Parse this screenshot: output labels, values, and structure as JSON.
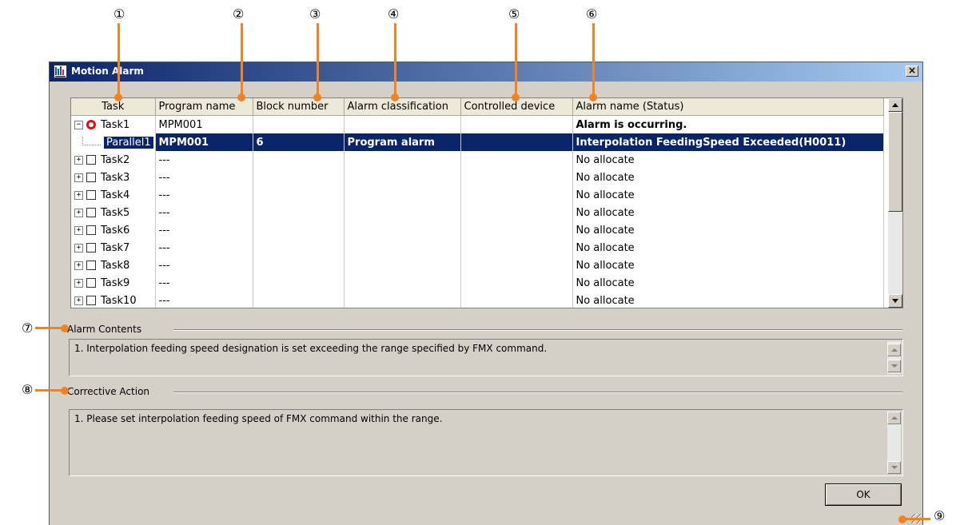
{
  "callouts": [
    "①",
    "②",
    "③",
    "④",
    "⑤",
    "⑥",
    "⑦",
    "⑧",
    "⑨"
  ],
  "window": {
    "title": "Motion Alarm",
    "close_glyph": "×"
  },
  "grid": {
    "columns": [
      "Task",
      "Program name",
      "Block number",
      "Alarm classification",
      "Controlled device",
      "Alarm name (Status)"
    ],
    "rows": [
      {
        "expander": "−",
        "marker": "alarm",
        "task": "Task1",
        "program": "MPM001",
        "block": "",
        "classification": "",
        "device": "",
        "status": "Alarm is occurring.",
        "status_style": "red"
      },
      {
        "expander": "",
        "marker": "child",
        "task": "Parallel1",
        "program": "MPM001",
        "block": "6",
        "classification": "Program alarm",
        "device": "",
        "status": "Interpolation FeedingSpeed Exceeded(H0011)",
        "selected": true
      },
      {
        "expander": "+",
        "marker": "check",
        "task": "Task2",
        "program": "---",
        "block": "",
        "classification": "",
        "device": "",
        "status": "No allocate"
      },
      {
        "expander": "+",
        "marker": "check",
        "task": "Task3",
        "program": "---",
        "block": "",
        "classification": "",
        "device": "",
        "status": "No allocate"
      },
      {
        "expander": "+",
        "marker": "check",
        "task": "Task4",
        "program": "---",
        "block": "",
        "classification": "",
        "device": "",
        "status": "No allocate"
      },
      {
        "expander": "+",
        "marker": "check",
        "task": "Task5",
        "program": "---",
        "block": "",
        "classification": "",
        "device": "",
        "status": "No allocate"
      },
      {
        "expander": "+",
        "marker": "check",
        "task": "Task6",
        "program": "---",
        "block": "",
        "classification": "",
        "device": "",
        "status": "No allocate"
      },
      {
        "expander": "+",
        "marker": "check",
        "task": "Task7",
        "program": "---",
        "block": "",
        "classification": "",
        "device": "",
        "status": "No allocate"
      },
      {
        "expander": "+",
        "marker": "check",
        "task": "Task8",
        "program": "---",
        "block": "",
        "classification": "",
        "device": "",
        "status": "No allocate"
      },
      {
        "expander": "+",
        "marker": "check",
        "task": "Task9",
        "program": "---",
        "block": "",
        "classification": "",
        "device": "",
        "status": "No allocate"
      },
      {
        "expander": "+",
        "marker": "check",
        "task": "Task10",
        "program": "---",
        "block": "",
        "classification": "",
        "device": "",
        "status": "No allocate"
      }
    ]
  },
  "alarm_contents": {
    "label": "Alarm Contents",
    "text": "1. Interpolation feeding speed designation is set exceeding the range specified by FMX command."
  },
  "corrective_action": {
    "label": "Corrective Action",
    "text": "1. Please set interpolation feeding speed of FMX command within the range."
  },
  "ok_button": {
    "label": "OK"
  },
  "colors": {
    "callout_orange": "#f58220",
    "selection_navy": "#0a246a",
    "alarm_red": "#ff0000",
    "dialog_gray": "#d4d0c8"
  },
  "icons": [
    "motion-alarm-app-icon",
    "close-icon",
    "expand-icon",
    "collapse-icon",
    "alarm-indicator-icon",
    "checkbox-icon",
    "scroll-up-icon",
    "scroll-down-icon",
    "resize-grip-icon"
  ]
}
